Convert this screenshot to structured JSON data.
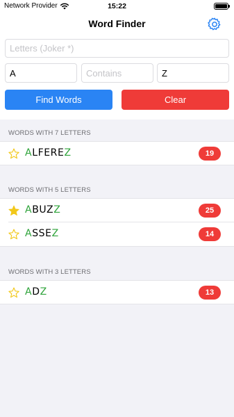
{
  "status_bar": {
    "carrier": "Network Provider",
    "time": "15:22"
  },
  "nav": {
    "title": "Word Finder"
  },
  "inputs": {
    "letters_placeholder": "Letters (Joker *)",
    "starts_with_value": "A",
    "contains_placeholder": "Contains",
    "ends_with_value": "Z"
  },
  "buttons": {
    "find_label": "Find Words",
    "clear_label": "Clear"
  },
  "colors": {
    "accent_blue": "#2a84f4",
    "danger_red": "#ef3b38",
    "match_green": "#2ea33a",
    "star_yellow": "#f2c81a"
  },
  "sections": [
    {
      "header": "WORDS WITH 7 LETTERS",
      "words": [
        {
          "start": "A",
          "middle": "LFERE",
          "end": "Z",
          "score": "19",
          "favorite": false
        }
      ]
    },
    {
      "header": "WORDS WITH 5 LETTERS",
      "words": [
        {
          "start": "A",
          "middle": "BUZ",
          "end": "Z",
          "score": "25",
          "favorite": true
        },
        {
          "start": "A",
          "middle": "SSE",
          "end": "Z",
          "score": "14",
          "favorite": false
        }
      ]
    },
    {
      "header": "WORDS WITH 3 LETTERS",
      "words": [
        {
          "start": "A",
          "middle": "D",
          "end": "Z",
          "score": "13",
          "favorite": false
        }
      ]
    }
  ]
}
